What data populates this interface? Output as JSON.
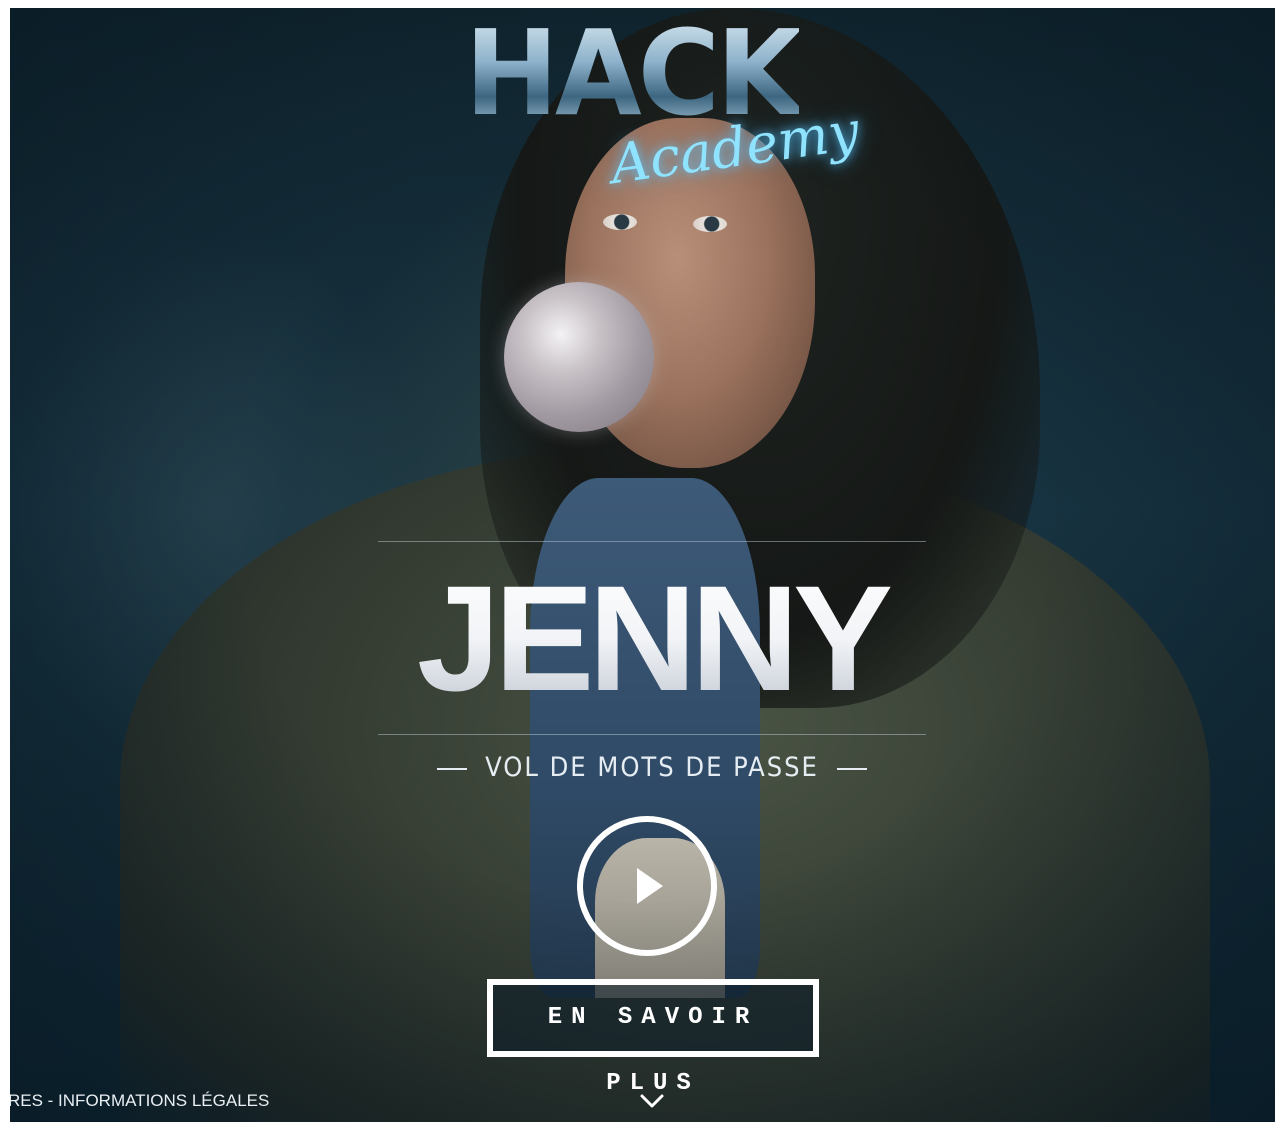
{
  "logo": {
    "main": "HACK",
    "sub": "Academy"
  },
  "hero": {
    "name": "JENNY",
    "topic": "VOL DE MOTS DE PASSE"
  },
  "actions": {
    "learn_more_label": "EN SAVOIR PLUS"
  },
  "footer": {
    "links_text": "RES - INFORMATIONS LÉGALES"
  },
  "icons": {
    "play": "play-icon",
    "scroll": "chevron-down-icon"
  },
  "colors": {
    "background": "#132c39",
    "logo_neon": "#8fe3ff",
    "text": "#ffffff"
  }
}
